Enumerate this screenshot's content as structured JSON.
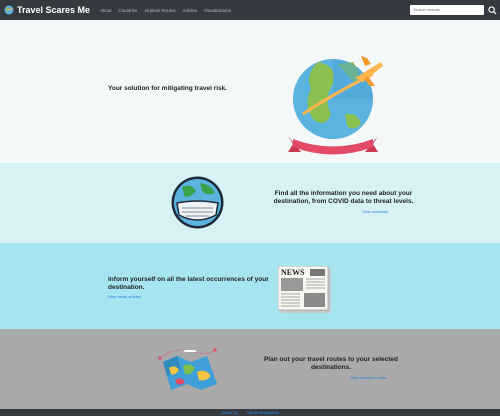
{
  "nav": {
    "brand": "Travel Scares Me",
    "links": [
      "About",
      "Countries",
      "Airplane Routes",
      "Articles",
      "Visualizations"
    ],
    "search_placeholder": "Search website"
  },
  "sections": {
    "hero": {
      "text": "Your solution for mitigating travel risk."
    },
    "countries": {
      "text_line1": "Find all the information you need about your",
      "text_line2": "destination, from COVID data to threat levels.",
      "link": "View countries"
    },
    "articles": {
      "text_line1": "Inform yourself on all the latest occurrences of your",
      "text_line2": "destination.",
      "link": "View news articles",
      "newspaper_title": "NEWS"
    },
    "routes": {
      "text_line1": "Plan out your travel routes to your selected",
      "text_line2": "destinations.",
      "link": "View airplane routes"
    }
  },
  "footer": {
    "links": [
      "About Us",
      "GitLab Repository"
    ]
  }
}
